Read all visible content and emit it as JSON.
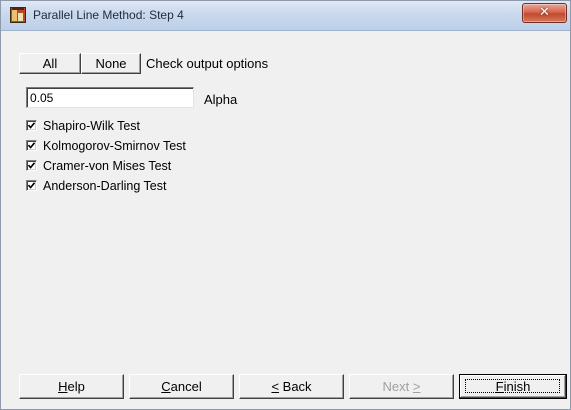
{
  "window": {
    "title": "Parallel Line Method: Step 4"
  },
  "top_buttons": {
    "all_label": "All",
    "none_label": "None",
    "options_label": "Check output options"
  },
  "alpha": {
    "value": "0.05",
    "label": "Alpha"
  },
  "tests": [
    {
      "label": "Shapiro-Wilk Test",
      "checked": true
    },
    {
      "label": "Kolmogorov-Smirnov Test",
      "checked": true
    },
    {
      "label": "Cramer-von Mises Test",
      "checked": true
    },
    {
      "label": "Anderson-Darling Test",
      "checked": true
    }
  ],
  "footer": {
    "help_rest": "elp",
    "cancel_rest": "ancel",
    "back_rest": " Back",
    "next_main": "Next ",
    "finish_rest": "inish",
    "next_enabled": false
  },
  "colors": {
    "dialog_bg": "#f0f0f0",
    "titlebar_top": "#dfe8f5",
    "close_button": "#c14a2e",
    "disabled_text": "#a0a0a0"
  },
  "icons": [
    "app-icon",
    "close-icon",
    "check-icon"
  ]
}
